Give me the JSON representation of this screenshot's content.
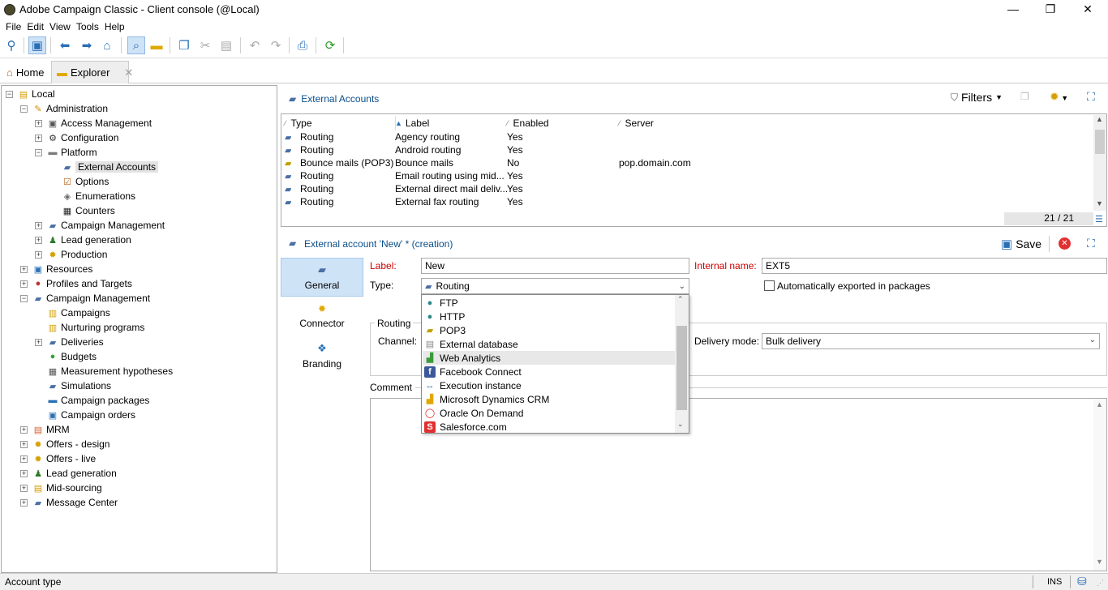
{
  "window": {
    "title": "Adobe Campaign Classic - Client console (@Local)",
    "minimize": "—",
    "maximize": "❐",
    "close": "✕"
  },
  "menu": [
    "File",
    "Edit",
    "View",
    "Tools",
    "Help"
  ],
  "tabs": {
    "home": "Home",
    "explorer": "Explorer",
    "close": "✕"
  },
  "tree": [
    {
      "label": "Local",
      "level": 0,
      "exp": "⊟",
      "icon": "db-icon"
    },
    {
      "label": "Administration",
      "level": 1,
      "exp": "⊟",
      "icon": "admin-icon"
    },
    {
      "label": "Access Management",
      "level": 2,
      "exp": "⊞",
      "icon": "lock-icon"
    },
    {
      "label": "Configuration",
      "level": 2,
      "exp": "⊞",
      "icon": "gear-icon"
    },
    {
      "label": "Platform",
      "level": 2,
      "exp": "⊟",
      "icon": "folder-icon"
    },
    {
      "label": "External Accounts",
      "level": 3,
      "exp": "",
      "icon": "account-icon",
      "selected": true
    },
    {
      "label": "Options",
      "level": 3,
      "exp": "",
      "icon": "options-icon"
    },
    {
      "label": "Enumerations",
      "level": 3,
      "exp": "",
      "icon": "enum-icon"
    },
    {
      "label": "Counters",
      "level": 3,
      "exp": "",
      "icon": "counter-icon"
    },
    {
      "label": "Campaign Management",
      "level": 2,
      "exp": "⊞",
      "icon": "campaign-icon"
    },
    {
      "label": "Lead generation",
      "level": 2,
      "exp": "⊞",
      "icon": "lead-icon"
    },
    {
      "label": "Production",
      "level": 2,
      "exp": "⊞",
      "icon": "production-icon"
    },
    {
      "label": "Resources",
      "level": 1,
      "exp": "⊞",
      "icon": "resources-icon"
    },
    {
      "label": "Profiles and Targets",
      "level": 1,
      "exp": "⊞",
      "icon": "profiles-icon"
    },
    {
      "label": "Campaign Management",
      "level": 1,
      "exp": "⊟",
      "icon": "campaign-icon"
    },
    {
      "label": "Campaigns",
      "level": 2,
      "exp": "",
      "icon": "campaigns-icon"
    },
    {
      "label": "Nurturing programs",
      "level": 2,
      "exp": "",
      "icon": "nurturing-icon"
    },
    {
      "label": "Deliveries",
      "level": 2,
      "exp": "⊞",
      "icon": "deliveries-icon"
    },
    {
      "label": "Budgets",
      "level": 2,
      "exp": "",
      "icon": "budgets-icon"
    },
    {
      "label": "Measurement hypotheses",
      "level": 2,
      "exp": "",
      "icon": "hypothesis-icon"
    },
    {
      "label": "Simulations",
      "level": 2,
      "exp": "",
      "icon": "simulations-icon"
    },
    {
      "label": "Campaign packages",
      "level": 2,
      "exp": "",
      "icon": "packages-icon"
    },
    {
      "label": "Campaign orders",
      "level": 2,
      "exp": "",
      "icon": "orders-icon"
    },
    {
      "label": "MRM",
      "level": 1,
      "exp": "⊞",
      "icon": "mrm-icon"
    },
    {
      "label": "Offers - design",
      "level": 1,
      "exp": "⊞",
      "icon": "offers-icon"
    },
    {
      "label": "Offers - live",
      "level": 1,
      "exp": "⊞",
      "icon": "offers-icon"
    },
    {
      "label": "Lead generation",
      "level": 1,
      "exp": "⊞",
      "icon": "lead-icon"
    },
    {
      "label": "Mid-sourcing",
      "level": 1,
      "exp": "⊞",
      "icon": "midsourcing-icon"
    },
    {
      "label": "Message Center",
      "level": 1,
      "exp": "⊞",
      "icon": "message-icon"
    }
  ],
  "list": {
    "title": "External Accounts",
    "filters": "Filters",
    "columns": [
      "Type",
      "Label",
      "Enabled",
      "Server"
    ],
    "rows": [
      [
        "Routing",
        "Agency routing",
        "Yes",
        ""
      ],
      [
        "Routing",
        "Android routing",
        "Yes",
        ""
      ],
      [
        "Bounce mails (POP3)",
        "Bounce mails",
        "No",
        "pop.domain.com"
      ],
      [
        "Routing",
        "Email routing using mid...",
        "Yes",
        ""
      ],
      [
        "Routing",
        "External direct mail deliv...",
        "Yes",
        ""
      ],
      [
        "Routing",
        "External fax routing",
        "Yes",
        ""
      ]
    ],
    "counter": "21 / 21"
  },
  "form": {
    "title": "External account 'New' * (creation)",
    "save": "Save",
    "sidetabs": [
      "General",
      "Connector",
      "Branding"
    ],
    "label_label": "Label:",
    "label_value": "New",
    "internal_label": "Internal name:",
    "internal_value": "EXT5",
    "type_label": "Type:",
    "type_value": "Routing",
    "auto_export": "Automatically exported in packages",
    "routing_group": "Routing",
    "channel_label": "Channel:",
    "delivery_mode_label": "Delivery mode:",
    "delivery_mode_value": "Bulk delivery",
    "comment_label": "Comment"
  },
  "dropdown": [
    {
      "label": "FTP",
      "icon": "globe-icon"
    },
    {
      "label": "HTTP",
      "icon": "globe-icon"
    },
    {
      "label": "POP3",
      "icon": "pop3-icon"
    },
    {
      "label": "External database",
      "icon": "database-icon"
    },
    {
      "label": "Web Analytics",
      "icon": "analytics-icon",
      "highlighted": true
    },
    {
      "label": "Facebook Connect",
      "icon": "facebook-icon"
    },
    {
      "label": "Execution instance",
      "icon": "execution-icon"
    },
    {
      "label": "Microsoft Dynamics CRM",
      "icon": "dynamics-icon"
    },
    {
      "label": "Oracle On Demand",
      "icon": "oracle-icon"
    },
    {
      "label": "Salesforce.com",
      "icon": "salesforce-icon"
    }
  ],
  "status": {
    "text": "Account type",
    "ins": "INS"
  }
}
